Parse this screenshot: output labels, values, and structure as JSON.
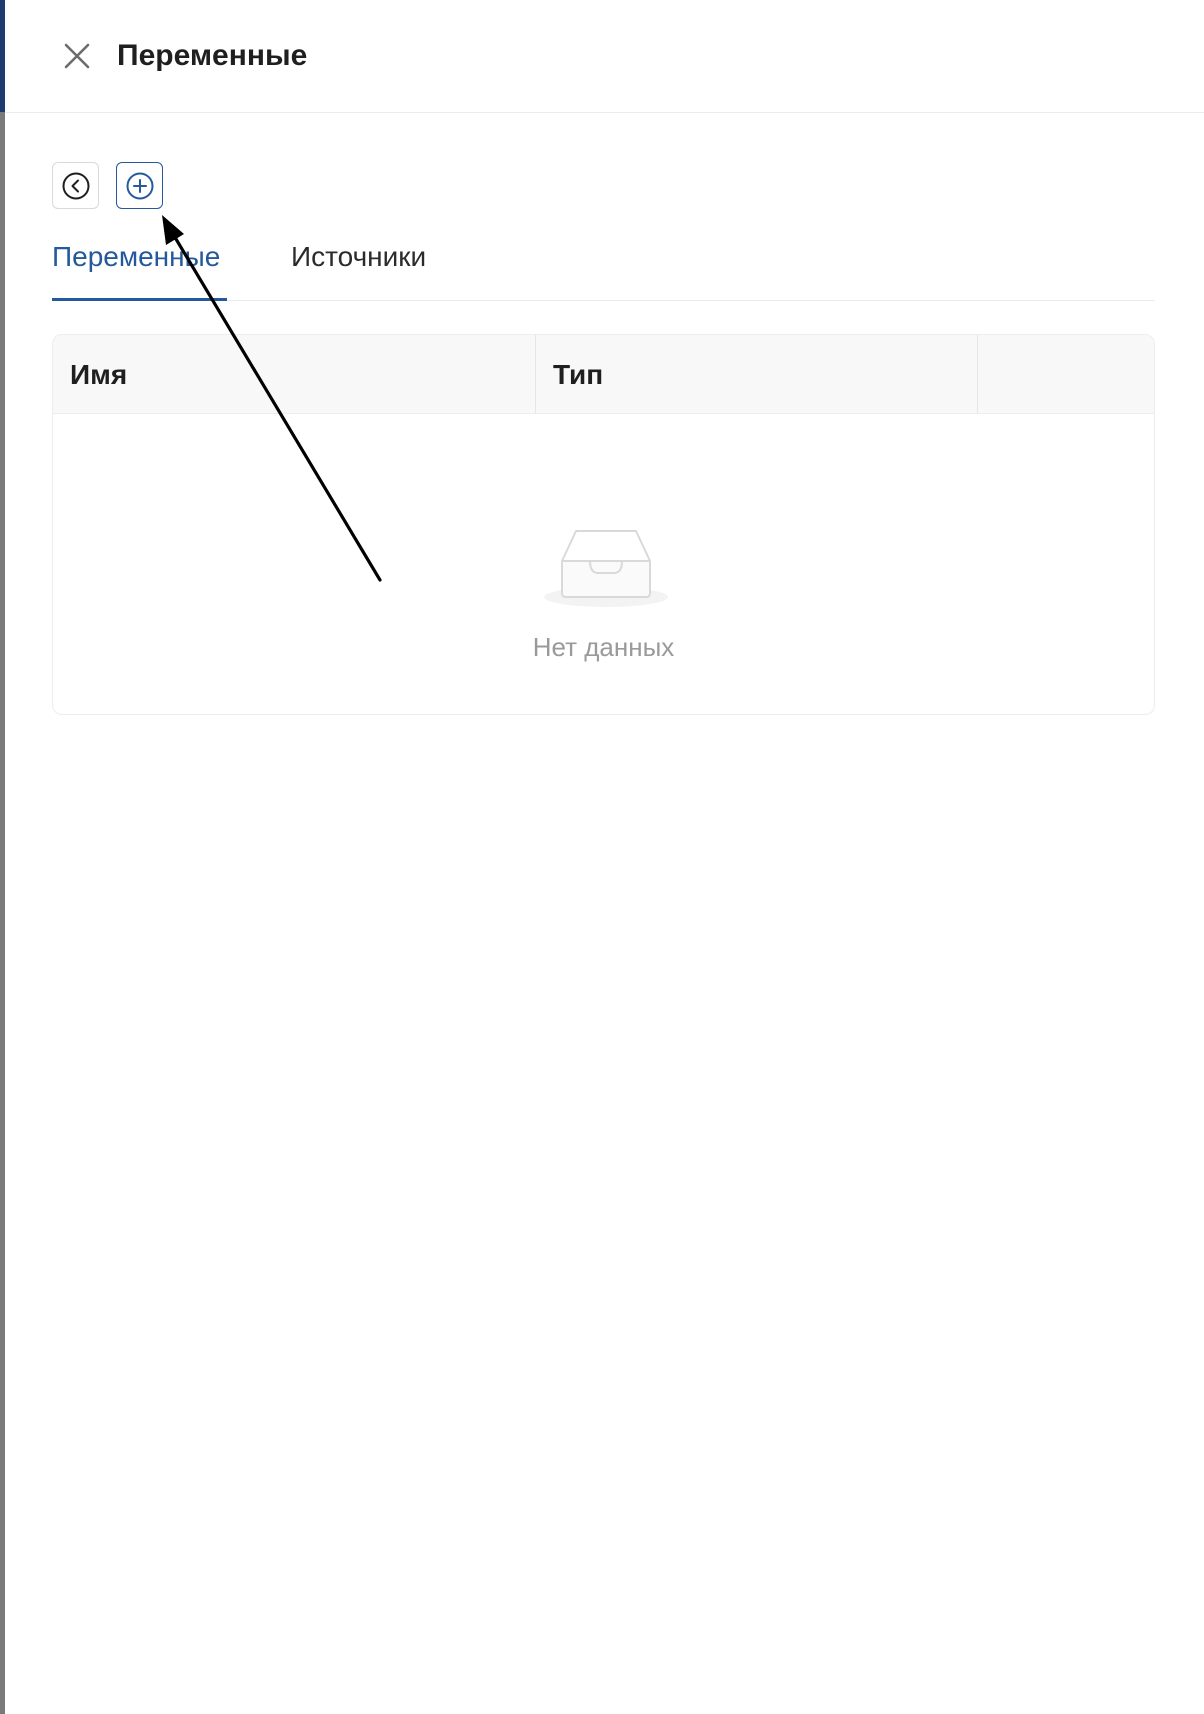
{
  "drawer": {
    "title": "Переменные",
    "close_icon": "close-icon"
  },
  "toolbar": {
    "back_icon": "circle-chevron-left-icon",
    "add_icon": "circle-plus-icon"
  },
  "tabs": [
    {
      "label": "Переменные",
      "active": true
    },
    {
      "label": "Источники",
      "active": false
    }
  ],
  "table": {
    "columns": [
      "Имя",
      "Тип",
      ""
    ],
    "empty_text": "Нет данных",
    "empty_icon": "empty-inbox-icon"
  },
  "colors": {
    "accent": "#24599c",
    "text": "#1f1f1f",
    "muted": "#9a9a9a"
  }
}
